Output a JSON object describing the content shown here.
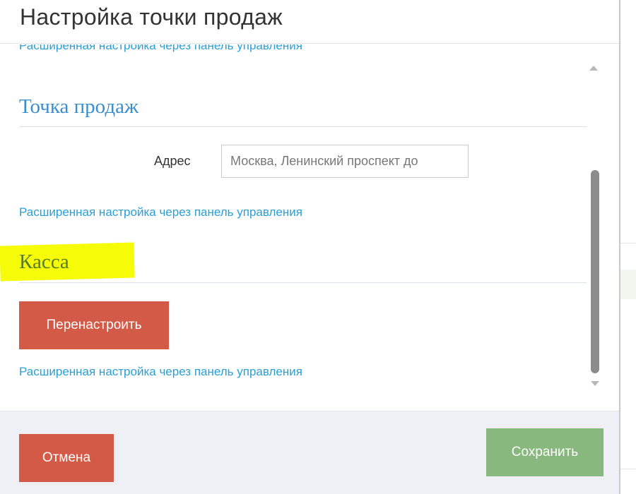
{
  "dialog": {
    "title": "Настройка точки продаж"
  },
  "body": {
    "cut_link": "Расширенная настройка через панель управления",
    "sales_point": {
      "title": "Точка продаж",
      "address_label": "Адрес",
      "address_value": "Москва, Ленинский проспект до",
      "advanced_link": "Расширенная настройка через панель управления"
    },
    "register": {
      "title": "Касса",
      "reconfigure_label": "Перенастроить",
      "advanced_link": "Расширенная настройка через панель управления"
    }
  },
  "footer": {
    "cancel_label": "Отмена",
    "save_label": "Сохранить"
  },
  "colors": {
    "link": "#2a9fd6",
    "danger": "#d35a47",
    "success": "#88b87e",
    "highlight": "#f6fb07"
  }
}
